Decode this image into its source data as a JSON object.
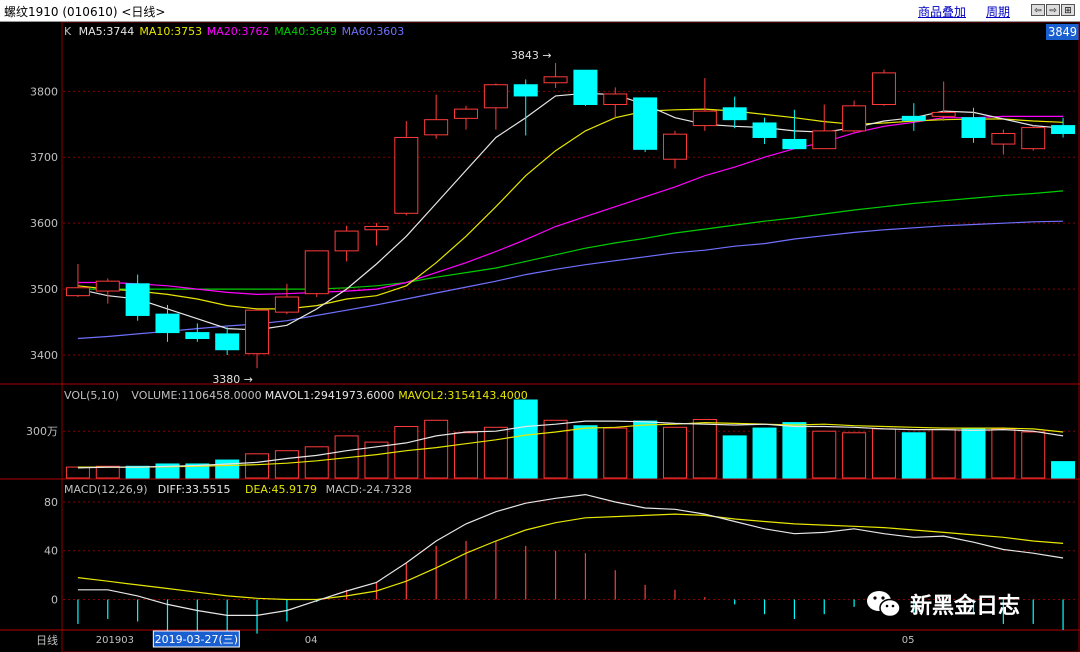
{
  "window": {
    "title": "螺纹1910 (010610) <日线>",
    "links": [
      "商品叠加",
      "周期"
    ],
    "buttons": [
      "⇦",
      "⇨",
      "⊞"
    ],
    "last_price": "3849"
  },
  "colors": {
    "background": "#000000",
    "up": "#ff3b3b",
    "down": "#00ffff",
    "ma5": "#e6e6e6",
    "ma10": "#e6e600",
    "ma20": "#ff00ff",
    "ma40": "#00cc00",
    "ma60": "#7070ff",
    "grid": "#8b0000"
  },
  "watermark": "新黑金日志",
  "chart_data": [
    {
      "type": "candlestick",
      "panel": "price",
      "legend": [
        {
          "text": "K",
          "color": "#c0c0c0"
        },
        {
          "text": "MA5:3744",
          "color": "#e6e6e6"
        },
        {
          "text": "MA10:3753",
          "color": "#e6e600"
        },
        {
          "text": "MA20:3762",
          "color": "#ff00ff"
        },
        {
          "text": "MA40:3649",
          "color": "#00cc00"
        },
        {
          "text": "MA60:3603",
          "color": "#7070ff"
        }
      ],
      "y_ticks": [
        3800,
        3700,
        3600,
        3500,
        3400
      ],
      "ylim": [
        3356,
        3890
      ],
      "annotations": [
        {
          "text": "3843",
          "value": 3843,
          "index": 16
        },
        {
          "text": "3380",
          "value": 3380,
          "index": 6
        }
      ],
      "candles": [
        {
          "o": 3490,
          "h": 3538,
          "l": 3488,
          "c": 3502
        },
        {
          "o": 3497,
          "h": 3516,
          "l": 3478,
          "c": 3512
        },
        {
          "o": 3508,
          "h": 3522,
          "l": 3452,
          "c": 3460
        },
        {
          "o": 3462,
          "h": 3476,
          "l": 3420,
          "c": 3434
        },
        {
          "o": 3434,
          "h": 3448,
          "l": 3420,
          "c": 3425
        },
        {
          "o": 3432,
          "h": 3442,
          "l": 3400,
          "c": 3408
        },
        {
          "o": 3402,
          "h": 3452,
          "l": 3380,
          "c": 3468
        },
        {
          "o": 3465,
          "h": 3508,
          "l": 3462,
          "c": 3488
        },
        {
          "o": 3493,
          "h": 3536,
          "l": 3488,
          "c": 3558
        },
        {
          "o": 3558,
          "h": 3596,
          "l": 3542,
          "c": 3588
        },
        {
          "o": 3590,
          "h": 3600,
          "l": 3566,
          "c": 3595
        },
        {
          "o": 3615,
          "h": 3755,
          "l": 3612,
          "c": 3730
        },
        {
          "o": 3734,
          "h": 3795,
          "l": 3728,
          "c": 3757
        },
        {
          "o": 3759,
          "h": 3778,
          "l": 3742,
          "c": 3773
        },
        {
          "o": 3775,
          "h": 3812,
          "l": 3742,
          "c": 3810
        },
        {
          "o": 3810,
          "h": 3818,
          "l": 3733,
          "c": 3793
        },
        {
          "o": 3813,
          "h": 3843,
          "l": 3805,
          "c": 3822
        },
        {
          "o": 3832,
          "h": 3832,
          "l": 3778,
          "c": 3780
        },
        {
          "o": 3780,
          "h": 3806,
          "l": 3760,
          "c": 3796
        },
        {
          "o": 3790,
          "h": 3790,
          "l": 3708,
          "c": 3712
        },
        {
          "o": 3697,
          "h": 3740,
          "l": 3683,
          "c": 3735
        },
        {
          "o": 3748,
          "h": 3820,
          "l": 3740,
          "c": 3770
        },
        {
          "o": 3775,
          "h": 3792,
          "l": 3744,
          "c": 3757
        },
        {
          "o": 3752,
          "h": 3760,
          "l": 3720,
          "c": 3730
        },
        {
          "o": 3727,
          "h": 3772,
          "l": 3715,
          "c": 3713
        },
        {
          "o": 3713,
          "h": 3780,
          "l": 3713,
          "c": 3740
        },
        {
          "o": 3740,
          "h": 3786,
          "l": 3738,
          "c": 3778
        },
        {
          "o": 3780,
          "h": 3833,
          "l": 3778,
          "c": 3828
        },
        {
          "o": 3762,
          "h": 3782,
          "l": 3740,
          "c": 3756
        },
        {
          "o": 3762,
          "h": 3815,
          "l": 3755,
          "c": 3768
        },
        {
          "o": 3760,
          "h": 3775,
          "l": 3722,
          "c": 3730
        },
        {
          "o": 3720,
          "h": 3742,
          "l": 3704,
          "c": 3736
        },
        {
          "o": 3713,
          "h": 3748,
          "l": 3710,
          "c": 3745
        },
        {
          "o": 3748,
          "h": 3760,
          "l": 3730,
          "c": 3736
        }
      ],
      "ma5": [
        3500,
        3490,
        3485,
        3470,
        3455,
        3440,
        3438,
        3445,
        3470,
        3500,
        3538,
        3580,
        3630,
        3680,
        3730,
        3760,
        3793,
        3797,
        3795,
        3780,
        3760,
        3750,
        3747,
        3745,
        3740,
        3738,
        3745,
        3755,
        3760,
        3770,
        3768,
        3758,
        3748,
        3744
      ],
      "ma10": [
        3505,
        3500,
        3497,
        3492,
        3485,
        3475,
        3470,
        3470,
        3475,
        3485,
        3490,
        3505,
        3540,
        3580,
        3625,
        3672,
        3710,
        3740,
        3760,
        3770,
        3772,
        3773,
        3770,
        3765,
        3760,
        3754,
        3750,
        3752,
        3755,
        3757,
        3758,
        3758,
        3755,
        3753
      ],
      "ma20": [
        3510,
        3510,
        3508,
        3505,
        3500,
        3495,
        3492,
        3493,
        3495,
        3497,
        3500,
        3510,
        3525,
        3540,
        3557,
        3575,
        3595,
        3610,
        3625,
        3640,
        3655,
        3672,
        3685,
        3700,
        3713,
        3723,
        3737,
        3747,
        3753,
        3760,
        3760,
        3762,
        3762,
        3762
      ],
      "ma40": [
        3500,
        3500,
        3500,
        3500,
        3500,
        3500,
        3500,
        3500,
        3500,
        3502,
        3505,
        3510,
        3518,
        3525,
        3532,
        3542,
        3552,
        3562,
        3570,
        3577,
        3585,
        3591,
        3597,
        3603,
        3608,
        3614,
        3620,
        3625,
        3630,
        3634,
        3638,
        3642,
        3645,
        3649
      ],
      "ma60": [
        3425,
        3428,
        3432,
        3436,
        3440,
        3444,
        3447,
        3452,
        3460,
        3468,
        3476,
        3485,
        3494,
        3503,
        3512,
        3522,
        3530,
        3537,
        3543,
        3549,
        3555,
        3559,
        3565,
        3569,
        3576,
        3581,
        3586,
        3590,
        3593,
        3596,
        3598,
        3600,
        3602,
        3603
      ]
    },
    {
      "type": "bar",
      "panel": "volume",
      "legend": [
        {
          "text": "VOL(5,10)",
          "color": "#c0c0c0"
        },
        {
          "text": "VOLUME:1106458.0000",
          "color": "#c0c0c0"
        },
        {
          "text": "MAVOL1:2941973.6000",
          "color": "#e6e6e6"
        },
        {
          "text": "MAVOL2:3154143.4000",
          "color": "#e6e600"
        }
      ],
      "y_tick_label": "300万",
      "y_tick_value": 3000000,
      "ylim": [
        0,
        5000000
      ],
      "values": [
        700000,
        750000,
        750000,
        900000,
        900000,
        1150000,
        1550000,
        1750000,
        2000000,
        2700000,
        2300000,
        3300000,
        3700000,
        2900000,
        3250000,
        5000000,
        3700000,
        3350000,
        3200000,
        3650000,
        3250000,
        3750000,
        2700000,
        3200000,
        3550000,
        3000000,
        2900000,
        3150000,
        2900000,
        3100000,
        3200000,
        3150000,
        2950000,
        1050000
      ],
      "up_flags": [
        1,
        1,
        0,
        0,
        0,
        0,
        1,
        1,
        1,
        1,
        1,
        1,
        1,
        1,
        1,
        0,
        1,
        0,
        1,
        0,
        1,
        1,
        0,
        0,
        0,
        1,
        1,
        1,
        0,
        1,
        0,
        1,
        1,
        0
      ],
      "mavol1": [
        650000,
        700000,
        700000,
        750000,
        800000,
        900000,
        1000000,
        1250000,
        1450000,
        1750000,
        2000000,
        2250000,
        2700000,
        2950000,
        3000000,
        3300000,
        3450000,
        3650000,
        3650000,
        3600000,
        3500000,
        3450000,
        3400000,
        3450000,
        3300000,
        3300000,
        3250000,
        3150000,
        3100000,
        3100000,
        3050000,
        3100000,
        3000000,
        2700000
      ],
      "mavol2": [
        700000,
        700000,
        700000,
        720000,
        750000,
        800000,
        850000,
        950000,
        1100000,
        1300000,
        1500000,
        1750000,
        1950000,
        2200000,
        2450000,
        2750000,
        2950000,
        3200000,
        3250000,
        3400000,
        3450000,
        3550000,
        3500000,
        3450000,
        3400000,
        3450000,
        3350000,
        3300000,
        3250000,
        3200000,
        3200000,
        3200000,
        3150000,
        2950000
      ]
    },
    {
      "type": "macd",
      "panel": "macd",
      "legend": [
        {
          "text": "MACD(12,26,9)",
          "color": "#c0c0c0"
        },
        {
          "text": "DIFF:33.5515",
          "color": "#e6e6e6"
        },
        {
          "text": "DEA:45.9179",
          "color": "#e6e600"
        },
        {
          "text": "MACD:-24.7328",
          "color": "#c0c0c0"
        }
      ],
      "y_ticks": [
        80,
        40,
        0
      ],
      "ylim": [
        -25,
        98
      ],
      "diff": [
        8,
        8,
        3,
        -4,
        -9,
        -13,
        -13,
        -9,
        -1,
        7,
        14,
        30,
        48,
        62,
        72,
        79,
        83,
        86,
        80,
        75,
        74,
        70,
        64,
        58,
        54,
        55,
        58,
        54,
        51,
        52,
        47,
        41,
        38,
        34
      ],
      "dea": [
        18,
        15,
        12,
        9,
        6,
        3,
        1,
        0,
        0,
        3,
        7,
        15,
        26,
        38,
        48,
        57,
        63,
        67,
        68,
        69,
        70,
        69,
        66,
        64,
        62,
        61,
        60,
        59,
        57,
        55,
        53,
        51,
        48,
        46
      ],
      "hist": [
        -20,
        -16,
        -18,
        -26,
        -30,
        -32,
        -28,
        -18,
        -2,
        8,
        14,
        30,
        44,
        48,
        48,
        44,
        40,
        38,
        24,
        12,
        8,
        2,
        -4,
        -12,
        -16,
        -12,
        -6,
        -10,
        -12,
        -6,
        -12,
        -20,
        -20,
        -25
      ]
    }
  ],
  "xaxis": {
    "period_label": "日线",
    "labels": [
      {
        "text": "201903",
        "index": 1
      },
      {
        "text": "04",
        "index": 8
      },
      {
        "text": "05",
        "index": 28
      }
    ],
    "cursor_label": "2019-03-27(三)",
    "cursor_index": 4
  }
}
